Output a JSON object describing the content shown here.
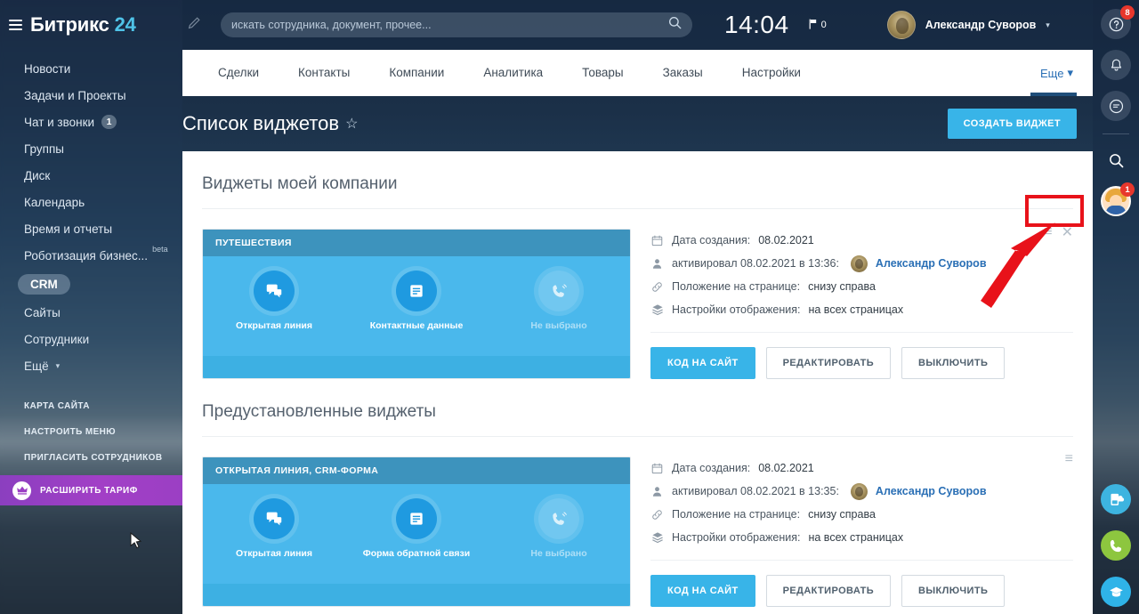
{
  "app": {
    "logo_text": "Битрикс",
    "logo_number": "24"
  },
  "header": {
    "search_placeholder": "искать сотрудника, документ, прочее...",
    "clock": "14:04",
    "flag_count": "0",
    "user_name": "Александр Суворов",
    "icons": {
      "burger": "menu-icon",
      "pencil": "pencil-icon",
      "search": "search-icon",
      "flag": "flag-icon",
      "caret": "chevron-down-icon"
    }
  },
  "sidebar": {
    "items": [
      {
        "label": "Новости"
      },
      {
        "label": "Задачи и Проекты"
      },
      {
        "label": "Чат и звонки",
        "counter": "1"
      },
      {
        "label": "Группы"
      },
      {
        "label": "Диск"
      },
      {
        "label": "Календарь"
      },
      {
        "label": "Время и отчеты"
      },
      {
        "label": "Роботизация бизнес...",
        "tag": "beta"
      },
      {
        "label": "CRM",
        "active": true
      },
      {
        "label": "Сайты"
      },
      {
        "label": "Сотрудники"
      },
      {
        "label": "Ещё",
        "caret": true
      }
    ],
    "secondary": [
      {
        "label": "Карта сайта"
      },
      {
        "label": "Настроить меню"
      },
      {
        "label": "Пригласить сотрудников"
      }
    ],
    "upgrade": {
      "label": "Расширить тариф",
      "icon": "crown-icon",
      "color": "#9b3fc4"
    }
  },
  "nav_tabs": [
    {
      "label": "Сделки"
    },
    {
      "label": "Контакты"
    },
    {
      "label": "Компании"
    },
    {
      "label": "Аналитика"
    },
    {
      "label": "Товары"
    },
    {
      "label": "Заказы"
    },
    {
      "label": "Настройки"
    }
  ],
  "more_tab": {
    "label": "Еще",
    "caret": "▾"
  },
  "page": {
    "title": "Список виджетов",
    "star_icon": "star-outline-icon",
    "create_button": "СОЗДАТЬ ВИДЖЕТ",
    "accent_color": "#38b4e8"
  },
  "sections": [
    {
      "title": "Виджеты моей компании",
      "widget": {
        "preview_title": "ПУТЕШЕСТВИЯ",
        "tiles": [
          {
            "label": "Открытая линия",
            "icon": "chat-icon",
            "muted": false
          },
          {
            "label": "Контактные данные",
            "icon": "document-icon",
            "muted": false
          },
          {
            "label": "Не выбрано",
            "icon": "phone-icon",
            "muted": true
          }
        ],
        "info": [
          {
            "icon": "calendar-icon",
            "label": "Дата создания:",
            "value": "08.02.2021"
          },
          {
            "icon": "person-icon",
            "label": "активировал 08.02.2021 в 13:36:",
            "value": "Александр Суворов",
            "is_person": true
          },
          {
            "icon": "link-icon",
            "label": "Положение на странице:",
            "value": "снизу справа"
          },
          {
            "icon": "layers-icon",
            "label": "Настройки отображения:",
            "value": "на всех страницах"
          }
        ],
        "buttons": [
          {
            "label": "КОД НА САЙТ",
            "style": "primary"
          },
          {
            "label": "РЕДАКТИРОВАТЬ",
            "style": "ghost"
          },
          {
            "label": "ВЫКЛЮЧИТЬ",
            "style": "ghost"
          }
        ],
        "actions": [
          {
            "icon": "hamburger-icon",
            "glyph": "≡"
          },
          {
            "icon": "close-icon",
            "glyph": "✕"
          }
        ]
      }
    },
    {
      "title": "Предустановленные виджеты",
      "widget": {
        "preview_title": "ОТКРЫТАЯ ЛИНИЯ, CRM-ФОРМА",
        "tiles": [
          {
            "label": "Открытая линия",
            "icon": "chat-icon",
            "muted": false
          },
          {
            "label": "Форма обратной связи",
            "icon": "document-icon",
            "muted": false
          },
          {
            "label": "Не выбрано",
            "icon": "phone-icon",
            "muted": true
          }
        ],
        "info": [
          {
            "icon": "calendar-icon",
            "label": "Дата создания:",
            "value": "08.02.2021"
          },
          {
            "icon": "person-icon",
            "label": "активировал 08.02.2021 в 13:35:",
            "value": "Александр Суворов",
            "is_person": true
          },
          {
            "icon": "link-icon",
            "label": "Положение на странице:",
            "value": "снизу справа"
          },
          {
            "icon": "layers-icon",
            "label": "Настройки отображения:",
            "value": "на всех страницах"
          }
        ],
        "buttons": [
          {
            "label": "КОД НА САЙТ",
            "style": "primary"
          },
          {
            "label": "РЕДАКТИРОВАТЬ",
            "style": "ghost"
          },
          {
            "label": "ВЫКЛЮЧИТЬ",
            "style": "ghost"
          }
        ],
        "actions": [
          {
            "icon": "hamburger-icon",
            "glyph": "≡"
          }
        ]
      }
    }
  ],
  "right_toolbar": {
    "items": [
      {
        "icon": "help-icon",
        "badge": "8"
      },
      {
        "icon": "bell-icon",
        "badge": null
      },
      {
        "icon": "chat-bubble-icon",
        "badge": null
      },
      {
        "icon": "search-icon",
        "badge": null,
        "plain": true
      },
      {
        "icon": "user-avatar-icon",
        "badge": "1",
        "avatar": true
      }
    ],
    "fabs": [
      {
        "icon": "site-widget-icon",
        "color": "#3db4e0"
      },
      {
        "icon": "phone-call-icon",
        "color": "#8dc63f"
      },
      {
        "icon": "graduation-cap-icon",
        "color": "#2fb3e8"
      }
    ]
  },
  "annotation": {
    "box_color": "#e8121a",
    "arrow_color": "#e8121a"
  }
}
